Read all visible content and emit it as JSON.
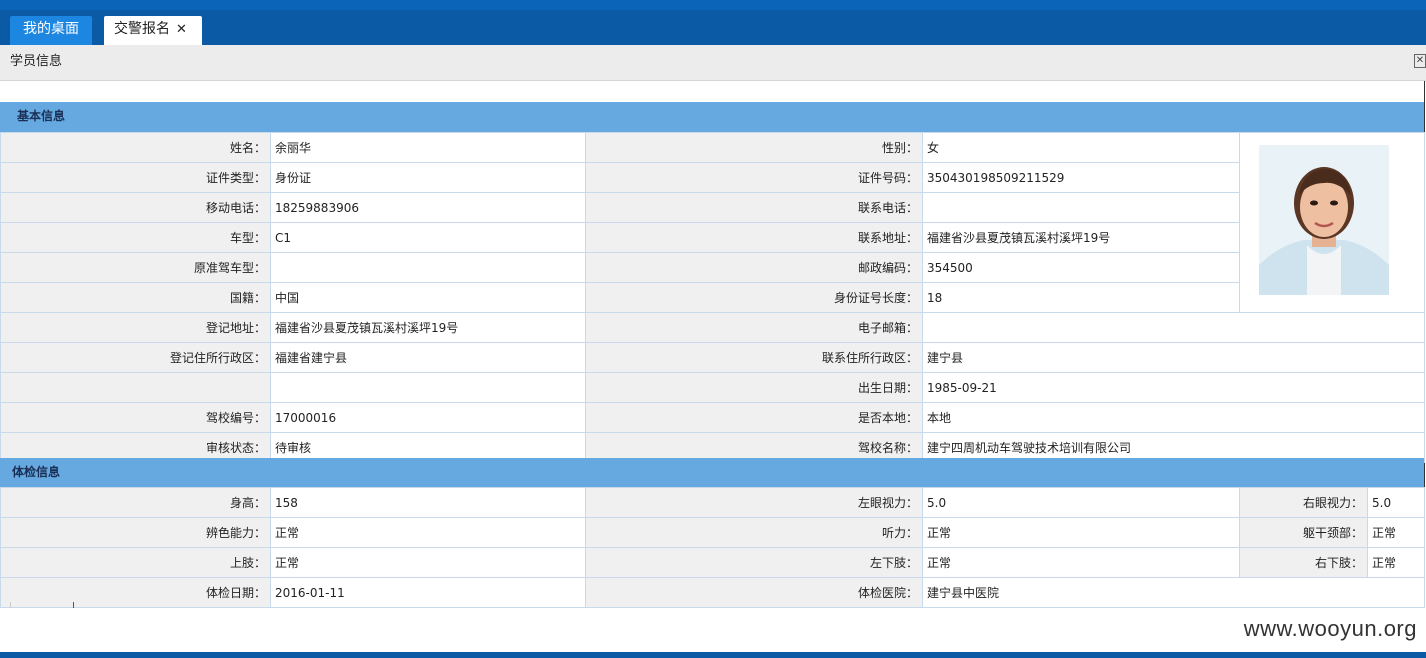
{
  "tabs": [
    {
      "label": "我的桌面",
      "active": false
    },
    {
      "label": "交警报名",
      "active": true,
      "close": "✕"
    }
  ],
  "panel": {
    "title": "学员信息"
  },
  "basic": {
    "title": "基本信息",
    "rows": [
      [
        "姓名：",
        "余丽华",
        "性别：",
        "女"
      ],
      [
        "证件类型：",
        "身份证",
        "证件号码：",
        "350430198509211529"
      ],
      [
        "移动电话：",
        "18259883906",
        "联系电话：",
        ""
      ],
      [
        "车型：",
        "C1",
        "联系地址：",
        "福建省沙县夏茂镇瓦溪村溪坪19号"
      ],
      [
        "原准驾车型：",
        "",
        "邮政编码：",
        "354500"
      ],
      [
        "国籍：",
        "中国",
        "身份证号长度：",
        "18"
      ],
      [
        "登记地址：",
        "福建省沙县夏茂镇瓦溪村溪坪19号",
        "电子邮箱：",
        ""
      ],
      [
        "登记住所行政区：",
        "福建省建宁县",
        "联系住所行政区：",
        "建宁县"
      ],
      [
        "",
        "",
        "出生日期：",
        "1985-09-21"
      ],
      [
        "驾校编号：",
        "17000016",
        "是否本地：",
        "本地"
      ],
      [
        "审核状态：",
        "待审核",
        "驾校名称：",
        "建宁四周机动车驾驶技术培训有限公司"
      ]
    ]
  },
  "exam": {
    "title": "体检信息",
    "rows": [
      [
        "身高：",
        "158",
        "左眼视力：",
        "5.0",
        "右眼视力：",
        "5.0"
      ],
      [
        "辨色能力：",
        "正常",
        "听力：",
        "正常",
        "躯干颈部：",
        "正常"
      ],
      [
        "上肢：",
        "正常",
        "左下肢：",
        "正常",
        "右下肢：",
        "正常"
      ],
      [
        "体检日期：",
        "2016-01-11",
        "体检医院：",
        "建宁县中医院",
        "",
        ""
      ]
    ]
  },
  "watermark": "www.wooyun.org",
  "colors": {
    "topbar": "#0a5aa6",
    "section": "#66a8e0",
    "label_bg": "#f0f0f0"
  },
  "icons": {
    "tab_close": "close-icon",
    "panel_close": "close-icon",
    "photo": "student-photo"
  }
}
